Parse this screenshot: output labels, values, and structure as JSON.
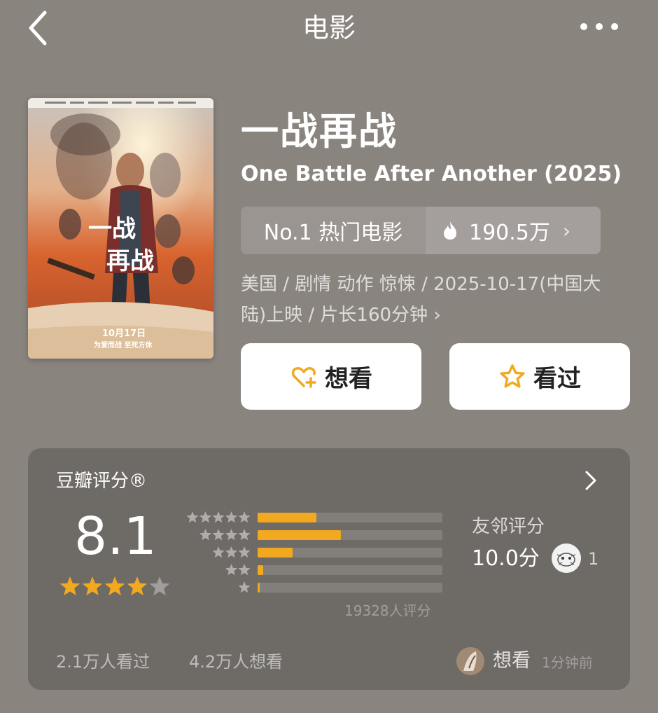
{
  "header": {
    "title": "电影",
    "back_icon": "chevron-left-icon",
    "more_icon": "more-dots-icon"
  },
  "movie": {
    "title_cn": "一战再战",
    "title_en": "One Battle After Another (2025)",
    "poster": {
      "title_lines": [
        "一战",
        "再战"
      ],
      "release": "10月17日",
      "tagline": "为爱而战 至死方休"
    },
    "rank": {
      "label": "No.1 热门电影",
      "heat": "190.5万",
      "chevron": "›"
    },
    "info_line1": "美国 / 剧情 动作 惊悚 / 2025-10-17(中国大",
    "info_line2": "陆)上映 / 片长160分钟 ›"
  },
  "actions": {
    "want": "想看",
    "watched": "看过"
  },
  "rating": {
    "label": "豆瓣评分®",
    "score": "8.1",
    "stars_filled": 4,
    "stars_total": 5,
    "distribution": [
      {
        "stars": 5,
        "fraction": 0.32
      },
      {
        "stars": 4,
        "fraction": 0.45
      },
      {
        "stars": 3,
        "fraction": 0.19
      },
      {
        "stars": 2,
        "fraction": 0.03
      },
      {
        "stars": 1,
        "fraction": 0.01
      }
    ],
    "count_text": "19328人评分",
    "friends": {
      "label": "友邻评分",
      "score": "10.0分",
      "count": "1"
    },
    "footer": {
      "watched": "2.1万人看过",
      "wished": "4.2万人想看",
      "activity": "想看",
      "time": "1分钟前"
    }
  },
  "colors": {
    "background": "#8a847f",
    "card": "#6e6a66",
    "star": "#f2a91f",
    "button_icon": "#f2a91f"
  }
}
